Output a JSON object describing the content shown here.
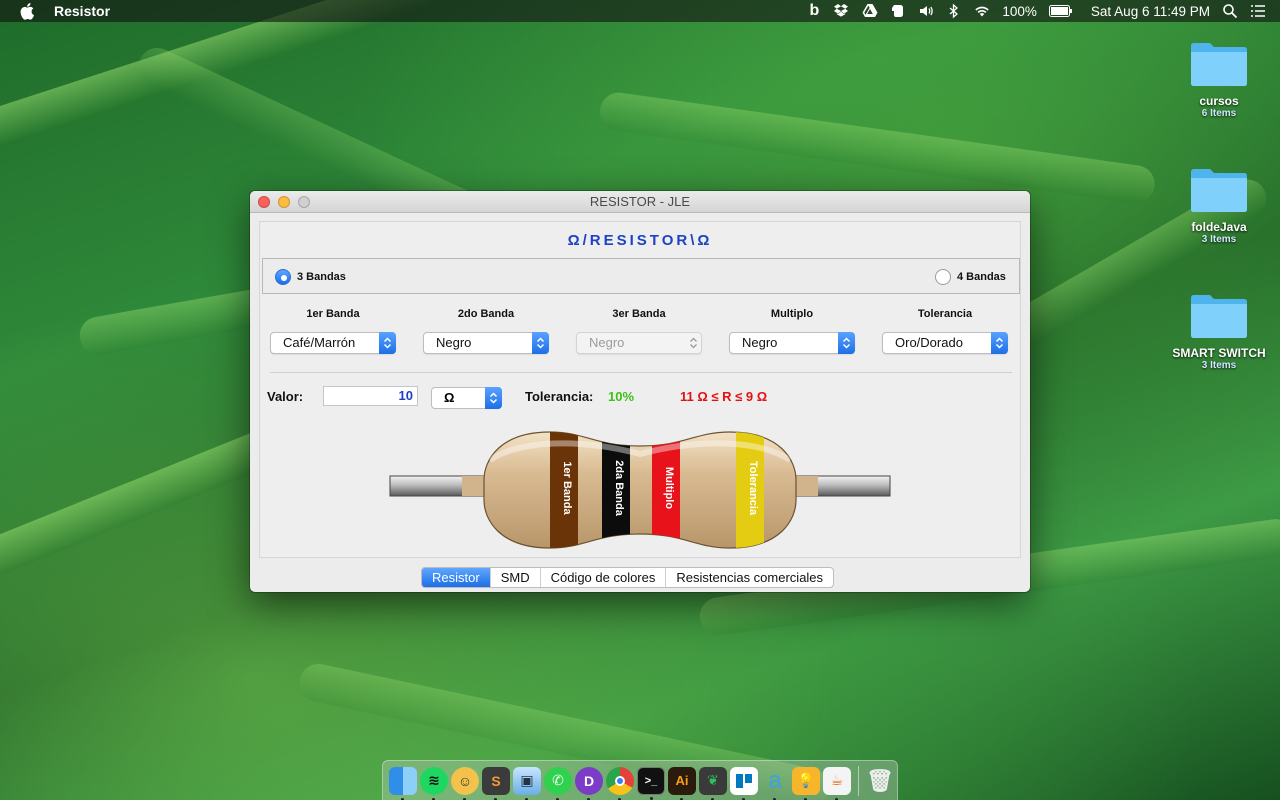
{
  "menubar": {
    "app_name": "Resistor",
    "battery": "100%",
    "datetime": "Sat Aug 6  11:49 PM"
  },
  "desktop": [
    {
      "name": "cursos",
      "count": "6 Items"
    },
    {
      "name": "foldeJava",
      "count": "3 Items"
    },
    {
      "name": "SMART SWITCH",
      "count": "3 Items"
    }
  ],
  "window": {
    "title": "RESISTOR - JLE",
    "app_title": "Ω/RESISTOR\\Ω",
    "radio_3": "3 Bandas",
    "radio_4": "4 Bandas",
    "columns": [
      {
        "label": "1er Banda",
        "value": "Café/Marrón"
      },
      {
        "label": "2do Banda",
        "value": "Negro"
      },
      {
        "label": "3er Banda",
        "value": "Negro"
      },
      {
        "label": "Multiplo",
        "value": "Negro"
      },
      {
        "label": "Tolerancia",
        "value": "Oro/Dorado"
      }
    ],
    "valor_label": "Valor:",
    "valor_value": "10",
    "unit": "Ω",
    "tol_label": "Tolerancia:",
    "tol_value": "10%",
    "range": "11 Ω ≤ R ≤ 9 Ω",
    "resistor_bands": [
      "1er Banda",
      "2da Banda",
      "Multiplo",
      "Tolerancia"
    ],
    "band_colors": [
      "#6b3408",
      "#0c0c0c",
      "#e8121a",
      "#e4cc12"
    ],
    "tabs": [
      "Resistor",
      "SMD",
      "Código de colores",
      "Resistencias comerciales"
    ]
  },
  "colors": {
    "accent": "#1c6fe6",
    "title_blue": "#1d43c4",
    "tolerance_green": "#3cc01a",
    "range_red": "#e31212"
  }
}
